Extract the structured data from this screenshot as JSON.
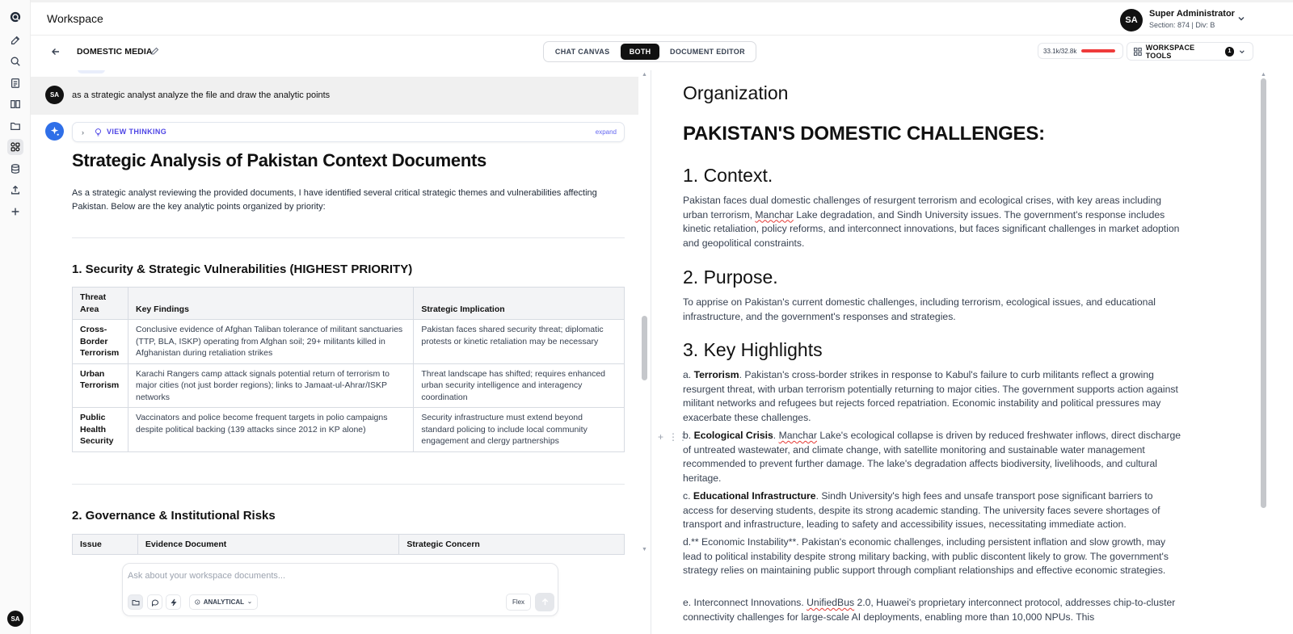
{
  "app": {
    "title": "Workspace"
  },
  "user": {
    "initials": "SA",
    "name": "Super Administrator",
    "section": "Section: 874 | Div: B"
  },
  "workspace": {
    "name": "DOMESTIC MEDIA"
  },
  "views": {
    "chat": "CHAT CANVAS",
    "both": "BOTH",
    "editor": "DOCUMENT EDITOR",
    "active": "BOTH"
  },
  "tokens": {
    "label": "33.1k/32.8k",
    "fill_fraction": 1.0,
    "color": "#ef3b3b"
  },
  "tools": {
    "label": "WORKSPACE TOOLS",
    "badge": "1"
  },
  "chat": {
    "user_message": {
      "initials": "SA",
      "text": "as a strategic analyst analyze the file and draw the analytic points"
    },
    "thinking": {
      "label": "VIEW THINKING",
      "expand": "expand"
    },
    "heading": "Strategic Analysis of Pakistan Context Documents",
    "intro": "As a strategic analyst reviewing the provided documents, I have identified several critical strategic themes and vulnerabilities affecting Pakistan. Below are the key analytic points organized by priority:",
    "section1": {
      "title": "1. Security & Strategic Vulnerabilities (HIGHEST PRIORITY)",
      "headers": [
        "Threat Area",
        "Key Findings",
        "Strategic Implication"
      ],
      "rows": [
        [
          "Cross-Border Terrorism",
          "Conclusive evidence of Afghan Taliban tolerance of militant sanctuaries (TTP, BLA, ISKP) operating from Afghan soil; 29+ militants killed in Afghanistan during retaliation strikes",
          "Pakistan faces shared security threat; diplomatic protests or kinetic retaliation may be necessary"
        ],
        [
          "Urban Terrorism",
          "Karachi Rangers camp attack signals potential return of terrorism to major cities (not just border regions); links to Jamaat-ul-Ahrar/ISKP networks",
          "Threat landscape has shifted; requires enhanced urban security intelligence and interagency coordination"
        ],
        [
          "Public Health Security",
          "Vaccinators and police become frequent targets in polio campaigns despite political backing (139 attacks since 2012 in KP alone)",
          "Security infrastructure must extend beyond standard policing to include local community engagement and clergy partnerships"
        ]
      ]
    },
    "section2": {
      "title": "2. Governance & Institutional Risks",
      "headers": [
        "Issue",
        "Evidence Document",
        "Strategic Concern"
      ]
    },
    "composer": {
      "placeholder": "Ask about your workspace documents...",
      "mode": "ANALYTICAL",
      "flex": "Flex"
    }
  },
  "document": {
    "org": "Organization",
    "title": "PAKISTAN'S DOMESTIC CHALLENGES:",
    "context_heading": "1. Context.",
    "context_pre": "Pakistan faces dual domestic challenges of resurgent terrorism and ecological crises, with key areas including urban terrorism, ",
    "context_misspelled": "Manchar",
    "context_post": " Lake degradation, and Sindh University issues. The government's response includes kinetic retaliation, policy reforms, and interconnect innovations, but faces significant challenges in market adoption and geopolitical constraints.",
    "purpose_heading": "2. Purpose.",
    "purpose": "To apprise on Pakistan's current domestic challenges, including terrorism, ecological issues, and educational infrastructure, and the government's responses and strategies.",
    "highlights_heading": "3. Key Highlights",
    "hl_a_prefix": "a. ",
    "hl_a_bold": "Terrorism",
    "hl_a_text": ". Pakistan's cross-border strikes in response to Kabul's failure to curb militants reflect a growing resurgent threat, with urban terrorism potentially returning to major cities. The government supports action against militant networks and refugees but rejects forced repatriation. Economic instability and political pressures may exacerbate these challenges.",
    "hl_b_prefix": "b. ",
    "hl_b_bold": "Ecological Crisis",
    "hl_b_sep": ". ",
    "hl_b_misspelled": "Manchar",
    "hl_b_text": " Lake's ecological collapse is driven by reduced freshwater inflows, direct discharge of untreated wastewater, and climate change, with satellite monitoring and sustainable water management recommended to prevent further damage. The lake's degradation affects biodiversity, livelihoods, and cultural heritage.",
    "hl_c_prefix": "c. ",
    "hl_c_bold": "Educational Infrastructure",
    "hl_c_text": ". Sindh University's high fees and unsafe transport pose significant barriers to access for deserving students, despite its strong academic standing. The university faces severe shortages of transport and infrastructure, leading to safety and accessibility issues, necessitating immediate action.",
    "hl_d": "d.** Economic Instability**. Pakistan's economic challenges, including persistent inflation and slow growth, may lead to political instability despite strong military backing, with public discontent likely to grow. The government's strategy relies on maintaining public support through compliant relationships and effective economic strategies.",
    "hl_e_pre": "e. Interconnect Innovations. ",
    "hl_e_misspelled": "UnifiedBus",
    "hl_e_post": " 2.0, Huawei's proprietary interconnect protocol, addresses chip-to-cluster connectivity challenges for large-scale AI deployments, enabling more than 10,000 NPUs. This"
  }
}
